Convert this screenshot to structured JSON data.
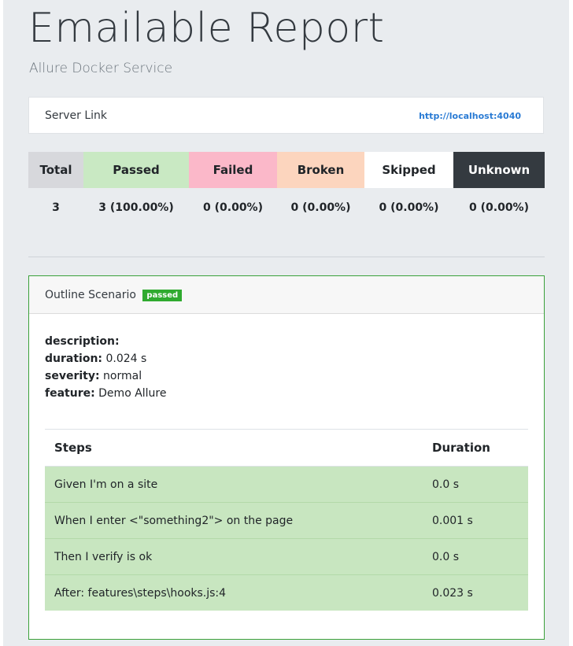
{
  "header": {
    "title": "Emailable Report",
    "subtitle": "Allure Docker Service"
  },
  "server": {
    "label": "Server Link",
    "link_text": "http://localhost:4040"
  },
  "stats": {
    "headers": [
      "Total",
      "Passed",
      "Failed",
      "Broken",
      "Skipped",
      "Unknown"
    ],
    "values": [
      "3",
      "3 (100.00%)",
      "0 (0.00%)",
      "0 (0.00%)",
      "0 (0.00%)",
      "0 (0.00%)"
    ],
    "colors": {
      "total": "#d7d8dc",
      "passed": "#c9e9c3",
      "failed": "#fbb8c9",
      "broken": "#fcd5be",
      "skipped": "#ffffff",
      "unknown": "#343a40"
    }
  },
  "scenario": {
    "name": "Outline Scenario",
    "status": "passed",
    "props": {
      "description_label": "description:",
      "description_value": "",
      "duration_label": "duration:",
      "duration_value": "0.024 s",
      "severity_label": "severity:",
      "severity_value": "normal",
      "feature_label": "feature:",
      "feature_value": "Demo Allure"
    },
    "steps_header": {
      "steps": "Steps",
      "duration": "Duration"
    },
    "steps": [
      {
        "name": "Given I'm on a site",
        "duration": "0.0 s"
      },
      {
        "name": "When I enter <\"something2\"> on the page",
        "duration": "0.001 s"
      },
      {
        "name": "Then I verify is ok",
        "duration": "0.0 s"
      },
      {
        "name": "After: features\\steps\\hooks.js:4",
        "duration": "0.023 s"
      }
    ]
  }
}
